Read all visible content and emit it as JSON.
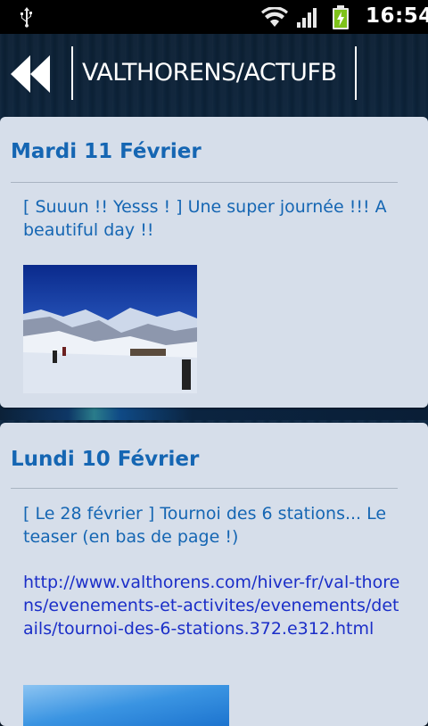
{
  "status_bar": {
    "time": "16:54",
    "icons": [
      "usb-icon",
      "wifi-icon",
      "signal-icon",
      "battery-charging-icon"
    ]
  },
  "header": {
    "title": "VALTHORENS/ACTUFB",
    "back_icon": "double-chevron-left-icon"
  },
  "posts": [
    {
      "date": "Mardi 11 Février",
      "text": "[ Suuun !! Yesss ! ] Une super journée !!! A beautiful day !!",
      "image": "snowy-mountain-ski-slope-photo"
    },
    {
      "date": "Lundi 10 Février",
      "text": "[ Le 28 février ] Tournoi des 6 stations... Le teaser (en bas de page !)",
      "link": "http://www.valthorens.com/hiver-fr/val-thorens/evenements-et-activites/evenements/details/tournoi-des-6-stations.372.e312.html",
      "image": "blue-sky-photo"
    }
  ],
  "colors": {
    "accent": "#1566b3",
    "link": "#1b2ec8",
    "card_bg": "#d6deea",
    "status_bar_bg": "#000000"
  }
}
